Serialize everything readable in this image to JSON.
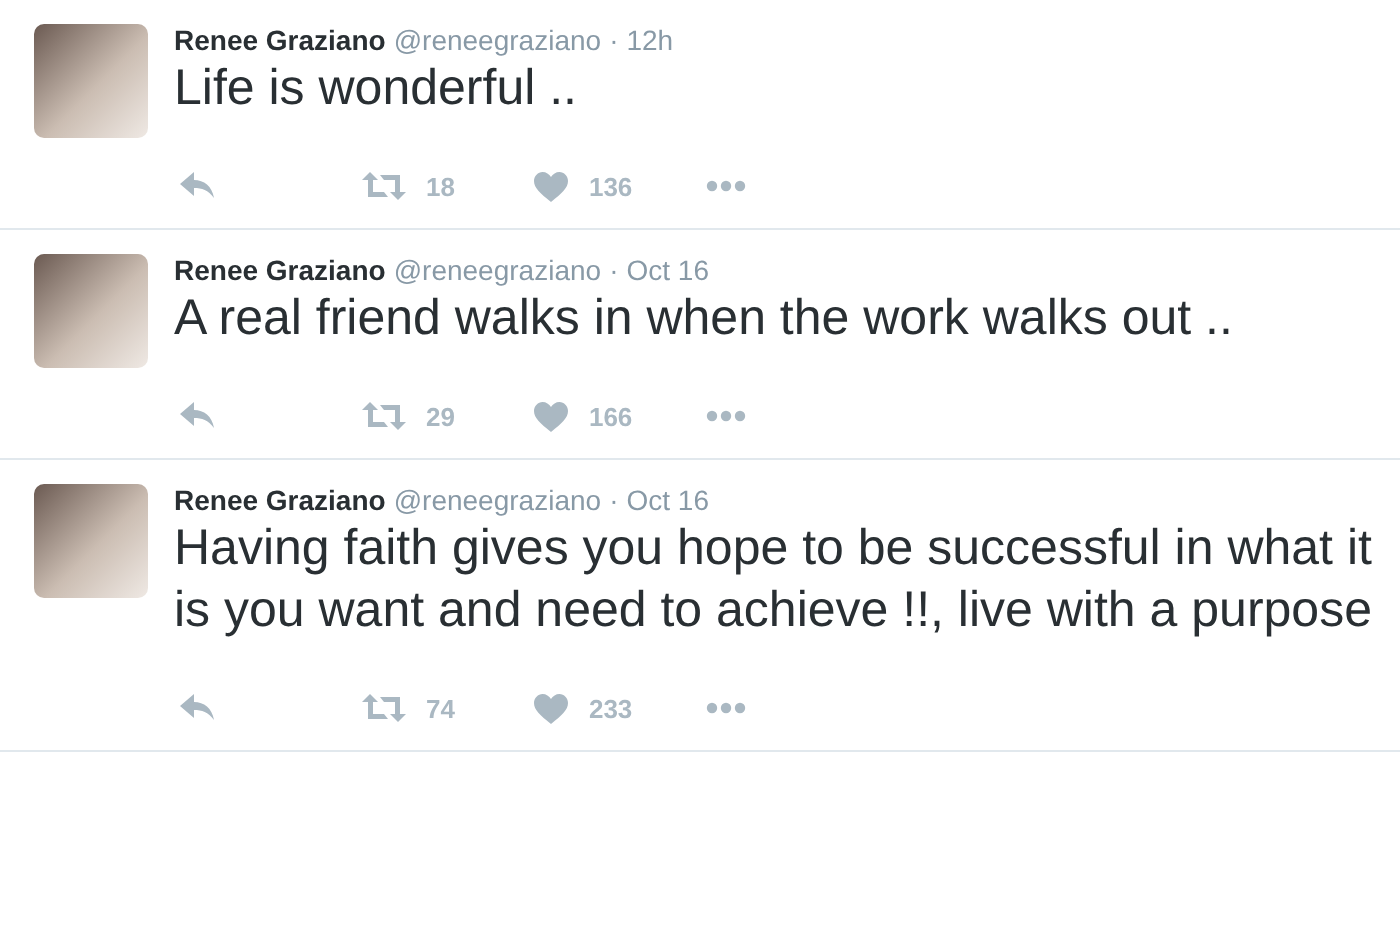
{
  "tweets": [
    {
      "name": "Renee Graziano",
      "handle": "@reneegraziano",
      "separator": "·",
      "time": "12h",
      "text": "Life is wonderful ..",
      "retweets": "18",
      "likes": "136"
    },
    {
      "name": "Renee Graziano",
      "handle": "@reneegraziano",
      "separator": "·",
      "time": "Oct 16",
      "text": "A real friend walks in when the work walks out ..",
      "retweets": "29",
      "likes": "166"
    },
    {
      "name": "Renee Graziano",
      "handle": "@reneegraziano",
      "separator": "·",
      "time": "Oct 16",
      "text": "Having faith gives you hope to be successful in what it is you want and need to achieve !!,  live with a purpose",
      "retweets": "74",
      "likes": "233"
    }
  ]
}
